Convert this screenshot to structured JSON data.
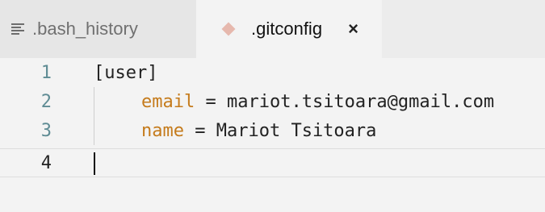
{
  "tabs": [
    {
      "label": ".bash_history",
      "icon": "lines-icon",
      "active": false
    },
    {
      "label": ".gitconfig",
      "icon": "diamond-icon",
      "active": true,
      "close": "×"
    }
  ],
  "editor": {
    "lines": [
      {
        "number": "1",
        "text": "[user]"
      },
      {
        "number": "2",
        "key": "email",
        "operator": " = ",
        "value": "mariot.tsitoara@gmail.com"
      },
      {
        "number": "3",
        "key": "name",
        "operator": " = ",
        "value": "Mariot Tsitoara"
      },
      {
        "number": "4",
        "text": ""
      }
    ],
    "current_line": "4",
    "colors": {
      "key": "#c57b1c",
      "line_number": "#5f8c94",
      "text": "#222222"
    }
  }
}
